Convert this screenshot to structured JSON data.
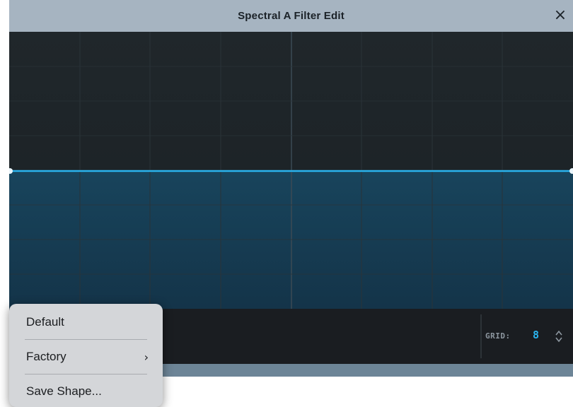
{
  "window": {
    "title": "Spectral A Filter Edit",
    "close_icon": "×"
  },
  "graph": {
    "grid_divisions": 8,
    "level_line_color": "#2ab4ef",
    "fill_color": "#164159"
  },
  "bottom_bar": {
    "grid_label": "GRID:",
    "grid_value": "8",
    "stepper_icon": "up-down-chevron-icon"
  },
  "context_menu": {
    "items": [
      {
        "label": "Default"
      },
      {
        "label": "Factory",
        "submenu_icon": "›"
      },
      {
        "label": "Save Shape..."
      }
    ]
  },
  "colors": {
    "titlebar": "#a6b4c1",
    "accent": "#2ab4ef",
    "graph_bg": "#1e2428",
    "status_strip": "#6d8597"
  }
}
